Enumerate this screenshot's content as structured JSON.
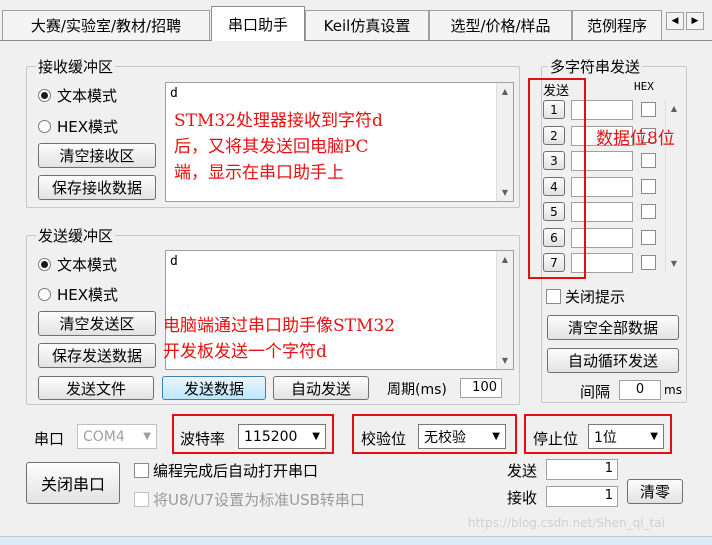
{
  "tabs": [
    "大赛/实验室/教材/招聘",
    "串口助手",
    "Keil仿真设置",
    "选型/价格/样品",
    "范例程序"
  ],
  "tab_scroll": {
    "left": "◀",
    "right": "▶"
  },
  "receive": {
    "title": "接收缓冲区",
    "mode_text": "文本模式",
    "mode_hex": "HEX模式",
    "selected_mode": "text",
    "clear_btn": "清空接收区",
    "save_btn": "保存接收数据",
    "content": "d"
  },
  "send": {
    "title": "发送缓冲区",
    "mode_text": "文本模式",
    "mode_hex": "HEX模式",
    "selected_mode": "text",
    "clear_btn": "清空发送区",
    "save_btn": "保存发送数据",
    "content": "d",
    "send_file_btn": "发送文件",
    "send_data_btn": "发送数据",
    "auto_send_btn": "自动发送",
    "period_label": "周期(ms)",
    "period_value": "100"
  },
  "multi": {
    "title": "多字符串发送",
    "col_send": "发送",
    "col_hex": "HEX",
    "rows": [
      "1",
      "2",
      "3",
      "4",
      "5",
      "6",
      "7"
    ],
    "close_tip": "关闭提示",
    "clear_all_btn": "清空全部数据",
    "auto_loop_btn": "自动循环发送",
    "interval_label": "间隔",
    "interval_value": "0",
    "interval_unit": "ms"
  },
  "port": {
    "label": "串口",
    "value": "COM4",
    "baud_label": "波特率",
    "baud_value": "115200",
    "parity_label": "校验位",
    "parity_value": "无校验",
    "stop_label": "停止位",
    "stop_value": "1位",
    "close_btn": "关闭串口",
    "auto_open": "编程完成后自动打开串口",
    "usb_opt": "将U8/U7设置为标准USB转串口"
  },
  "counters": {
    "send_label": "发送",
    "send_value": "1",
    "recv_label": "接收",
    "recv_value": "1",
    "clear_btn": "清零"
  },
  "annotations": {
    "recv_note": [
      "STM32处理器接收到字符d",
      "后，又将其发送回电脑PC",
      "端，显示在串口助手上"
    ],
    "send_note": [
      "电脑端通过串口助手像STM32",
      "开发板发送一个字符d"
    ],
    "data_bits": "数据位8位"
  },
  "watermark": "https://blog.csdn.net/Shen_qi_tai",
  "colors": {
    "annotation": "#e81010",
    "window_bg": "#f0f0f0"
  }
}
